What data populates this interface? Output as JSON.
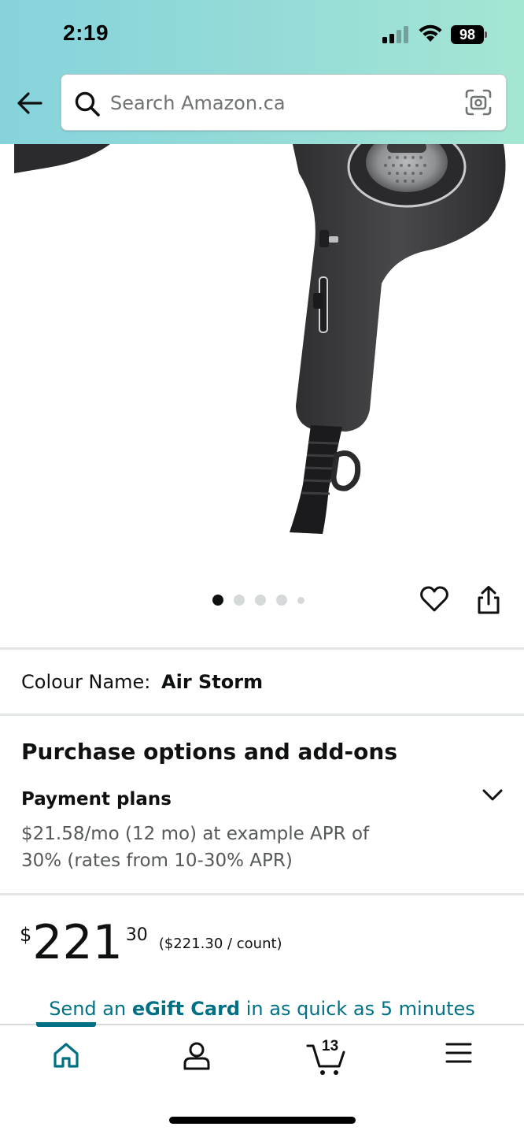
{
  "status_bar": {
    "time": "2:19",
    "battery": "98"
  },
  "search": {
    "placeholder": "Search Amazon.ca"
  },
  "carousel": {
    "total_images": 5,
    "active_index": 0
  },
  "product": {
    "colour_label": "Colour Name:",
    "colour_value": "Air Storm"
  },
  "purchase": {
    "title": "Purchase options and add-ons",
    "payment_title": "Payment plans",
    "payment_detail": "$21.58/mo (12 mo) at example APR of 30% (rates from 10-30% APR)"
  },
  "price": {
    "symbol": "$",
    "whole": "221",
    "fraction": "30",
    "unit_price": "($221.30 / count)"
  },
  "egift": {
    "prefix": "Send an ",
    "bold": "eGift Card",
    "suffix": " in as quick as 5 minutes"
  },
  "bottom_nav": {
    "cart_count": "13",
    "active": "home"
  },
  "colors": {
    "accent": "#007185",
    "header_start": "#86d3dc",
    "header_end": "#a5e6d3",
    "text": "#0f1111",
    "secondary_text": "#565959"
  },
  "icons": [
    "back-arrow-icon",
    "search-icon",
    "camera-icon",
    "heart-icon",
    "share-icon",
    "chevron-down-icon",
    "home-icon",
    "account-icon",
    "cart-icon",
    "menu-icon"
  ]
}
